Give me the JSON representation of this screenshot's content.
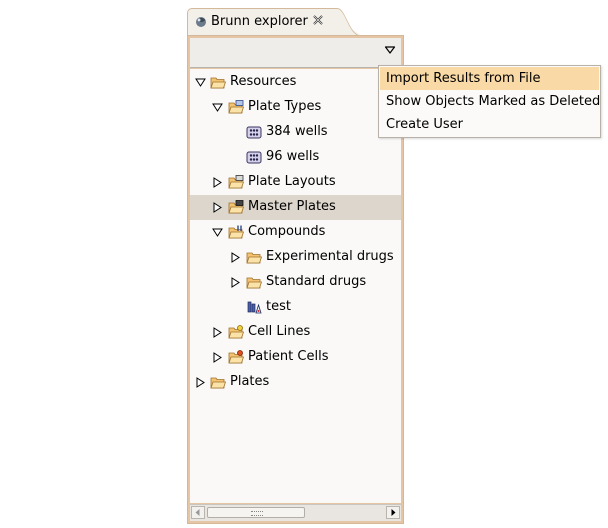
{
  "view": {
    "title": "Brunn explorer",
    "icons": {
      "tab": "ball-icon",
      "close": "close-icon",
      "view_menu": "chevron-down-icon"
    }
  },
  "tree": {
    "items": [
      {
        "label": "Resources",
        "icon": "folder-open-icon",
        "expanded": true
      },
      {
        "label": "Plate Types",
        "icon": "folder-open-icon",
        "expanded": true
      },
      {
        "label": "384 wells",
        "icon": "plate-icon"
      },
      {
        "label": "96 wells",
        "icon": "plate-icon"
      },
      {
        "label": "Plate Layouts",
        "icon": "folder-open-icon",
        "expanded": false
      },
      {
        "label": "Master Plates",
        "icon": "folder-open-icon",
        "expanded": false,
        "selected": true
      },
      {
        "label": "Compounds",
        "icon": "folder-open-icon",
        "expanded": true
      },
      {
        "label": "Experimental drugs",
        "icon": "folder-open-icon",
        "expanded": false
      },
      {
        "label": "Standard drugs",
        "icon": "folder-open-icon",
        "expanded": false
      },
      {
        "label": "test",
        "icon": "compound-icon"
      },
      {
        "label": "Cell Lines",
        "icon": "folder-open-icon",
        "expanded": false
      },
      {
        "label": "Patient Cells",
        "icon": "folder-open-icon",
        "expanded": false
      },
      {
        "label": "Plates",
        "icon": "folder-open-icon",
        "expanded": false
      }
    ]
  },
  "menu": {
    "items": [
      {
        "label": "Import Results from File",
        "active": true
      },
      {
        "label": "Show Objects Marked as Deleted"
      },
      {
        "label": "Create User"
      }
    ]
  },
  "colors": {
    "frame_border": "#d4b89a",
    "selection": "#ddd6cc",
    "menu_highlight": "#f9d9a6"
  }
}
